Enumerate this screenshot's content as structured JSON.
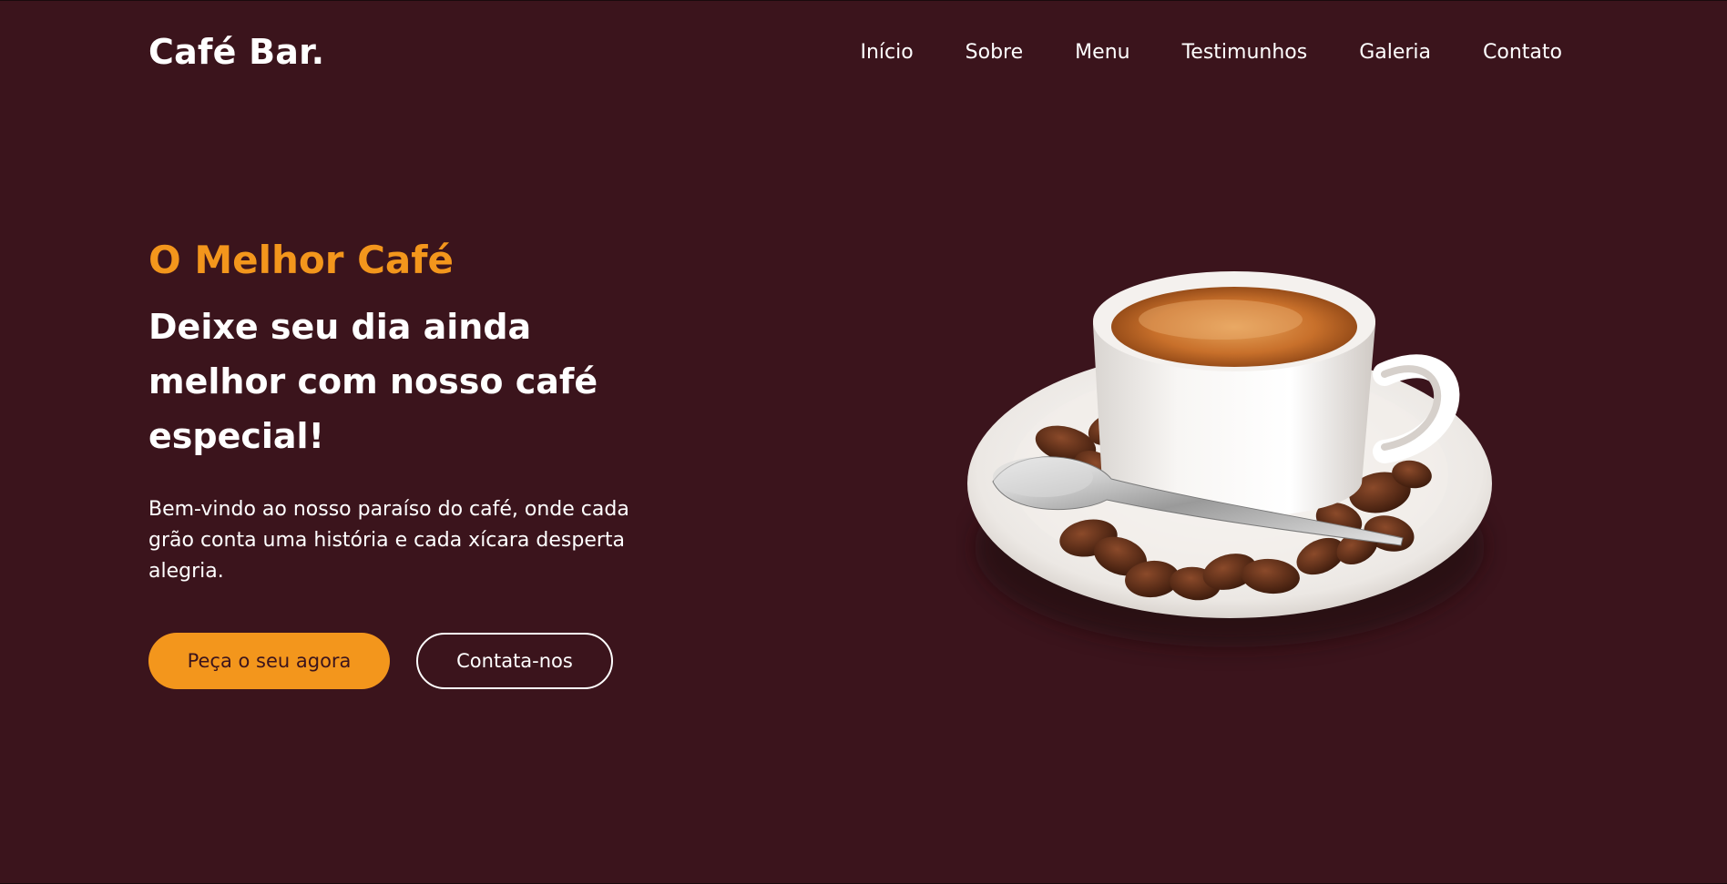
{
  "header": {
    "logo": "Café Bar.",
    "nav": [
      "Início",
      "Sobre",
      "Menu",
      "Testimunhos",
      "Galeria",
      "Contato"
    ]
  },
  "hero": {
    "subtitle": "O Melhor Café",
    "headline": "Deixe seu dia ainda melhor com nosso café especial!",
    "description": "Bem-vindo ao nosso paraíso do café, onde cada grão conta uma história e cada xícara desperta alegria.",
    "primary_button": "Peça o seu agora",
    "secondary_button": "Contata-nos",
    "image_icon": "coffee-cup-icon"
  },
  "colors": {
    "background": "#3b141c",
    "accent": "#f3961c",
    "text": "#ffffff"
  }
}
